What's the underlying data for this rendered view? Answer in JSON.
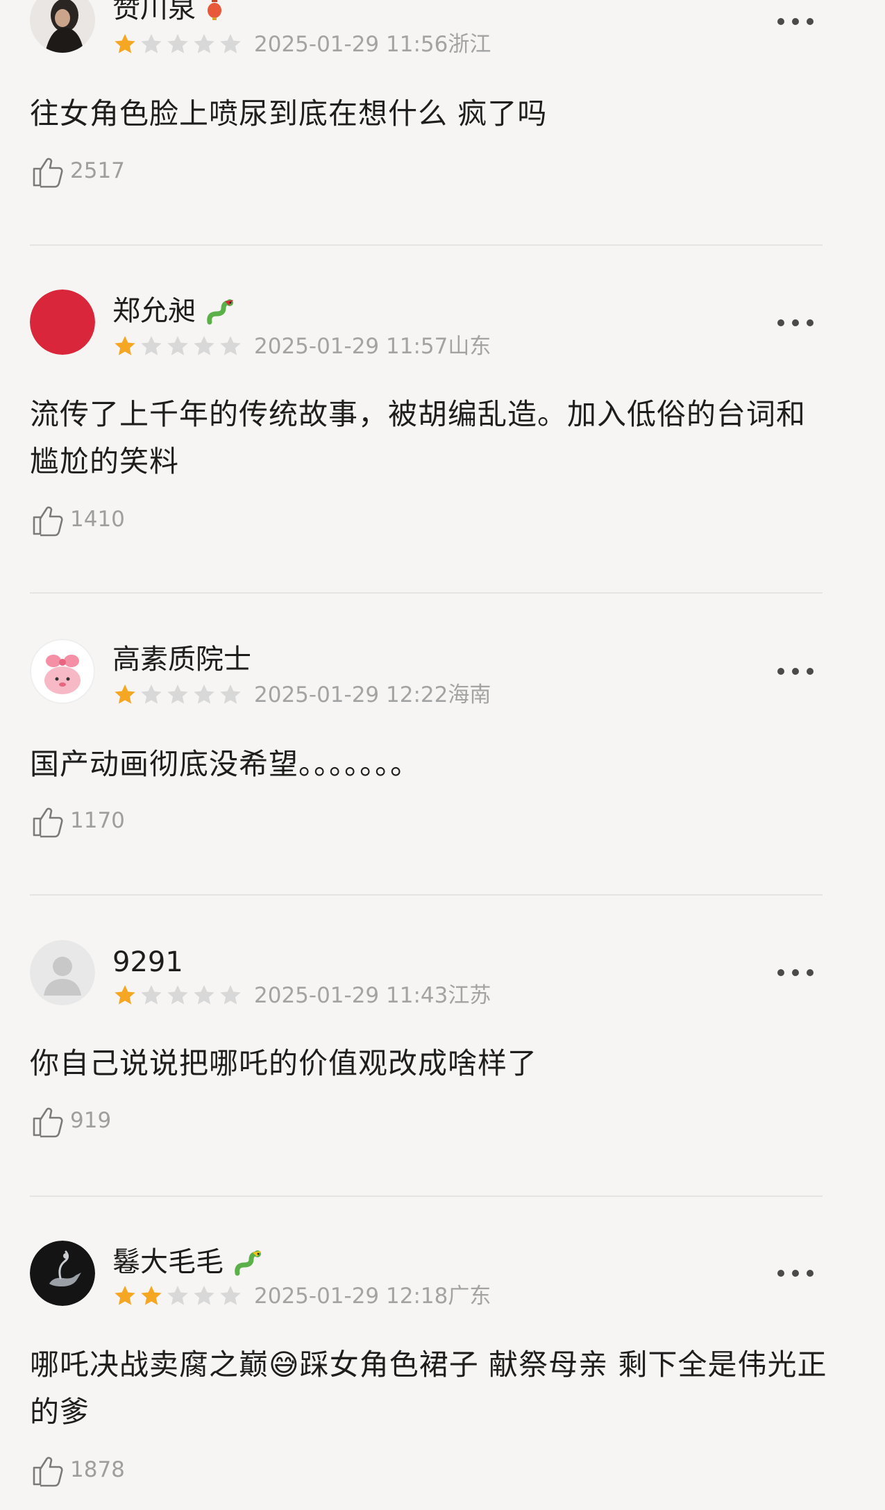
{
  "comments": [
    {
      "username": "赞川泉",
      "avatar_icon": "dark-portrait-avatar",
      "badge_icon": "red-lantern-badge-icon",
      "rating": 1,
      "max_rating": 5,
      "date": "2025-01-29 11:56",
      "location": "浙江",
      "text": "往女角色脸上喷尿到底在想什么        疯了吗",
      "likes": "2517"
    },
    {
      "username": "郑允昶",
      "avatar_icon": "red-circle-avatar",
      "badge_icon": "snake-badge-icon",
      "rating": 1,
      "max_rating": 5,
      "date": "2025-01-29 11:57",
      "location": "山东",
      "text": "流传了上千年的传统故事，被胡编乱造。加入低俗的台词和尴尬的笑料",
      "likes": "1410"
    },
    {
      "username": "高素质院士",
      "avatar_icon": "pink-cartoon-avatar",
      "badge_icon": "",
      "rating": 1,
      "max_rating": 5,
      "date": "2025-01-29 12:22",
      "location": "海南",
      "text": "国产动画彻底没希望。。。。。。。",
      "likes": "1170"
    },
    {
      "username": "9291",
      "avatar_icon": "default-user-avatar",
      "badge_icon": "",
      "rating": 1,
      "max_rating": 5,
      "date": "2025-01-29 11:43",
      "location": "江苏",
      "text": "你自己说说把哪吒的价值观改成啥样了",
      "likes": "919"
    },
    {
      "username": "鬈大毛毛",
      "avatar_icon": "dark-genie-lamp-avatar",
      "badge_icon": "snake-badge-icon",
      "rating": 2,
      "max_rating": 5,
      "date": "2025-01-29 12:18",
      "location": "广东",
      "text": "哪吒决战卖腐之巅😅踩女角色裙子 献祭母亲 剩下全是伟光正的爹",
      "likes": "1878"
    }
  ],
  "colors": {
    "star_filled": "#f5a623",
    "star_empty": "#d8d8d8",
    "meta_text": "#a3a3a3",
    "background": "#f6f5f3"
  }
}
